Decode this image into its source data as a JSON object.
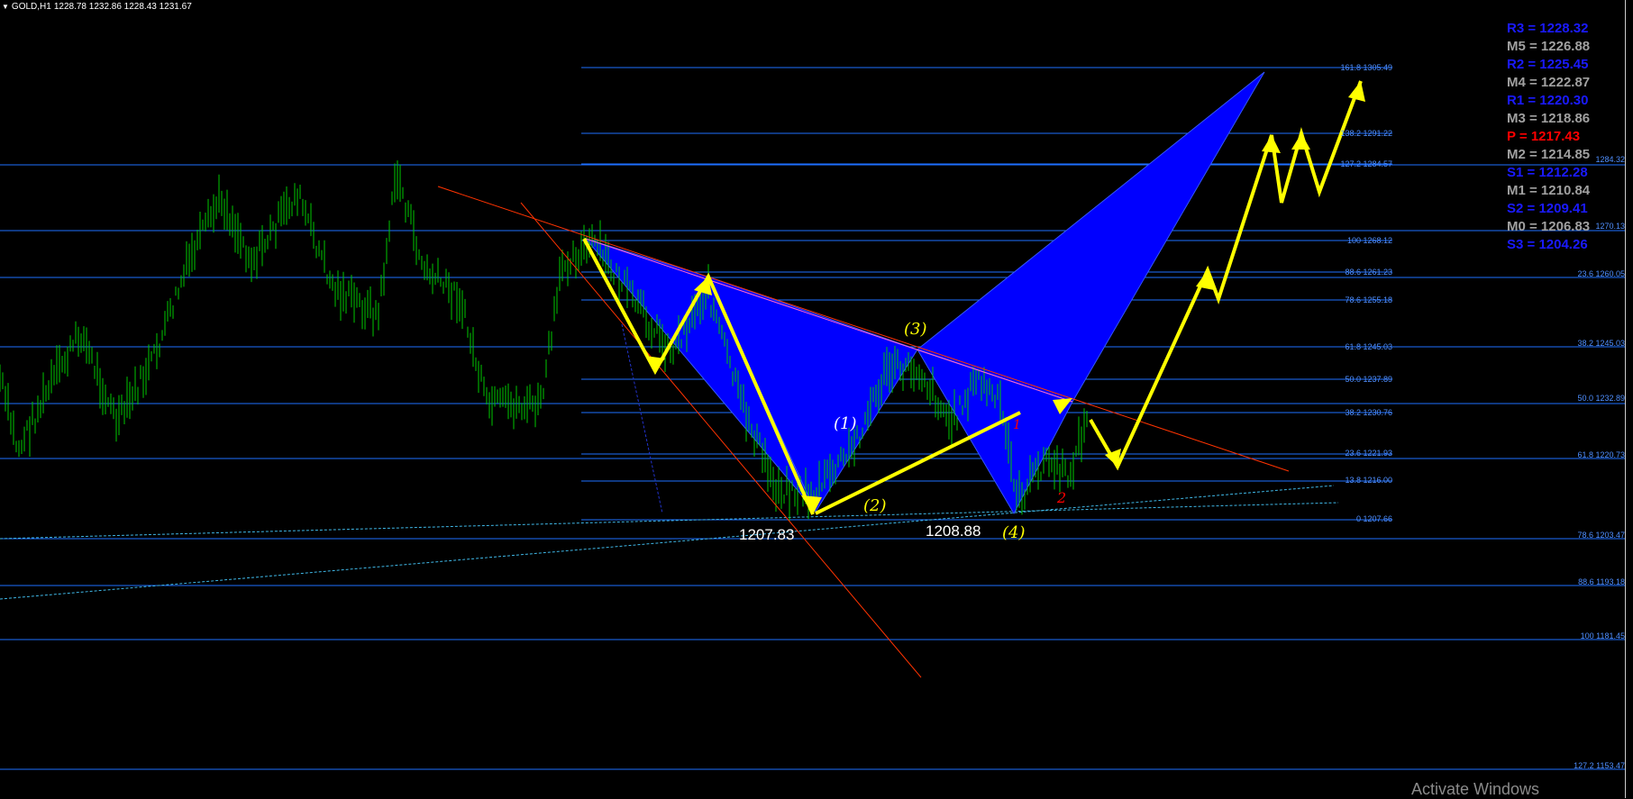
{
  "window": {
    "symbol_title": "GOLD,H1",
    "ohlc": "1228.78 1232.86 1228.43 1231.67"
  },
  "colors": {
    "background": "#000000",
    "candles": "#00c800",
    "fib_lines": "#1e6fff",
    "harmonic_fill": "#0000ff",
    "projection_arrows": "#ffff00",
    "trendline": "#ff3300",
    "pivot_blue": "#0000ff",
    "pivot_gray": "#909090",
    "pivot_red": "#ff0000"
  },
  "pivots": [
    {
      "label": "R3 = 1228.32",
      "color": "#1a1aff"
    },
    {
      "label": "M5 = 1226.88",
      "color": "#a0a0a0"
    },
    {
      "label": "R2 = 1225.45",
      "color": "#1a1aff"
    },
    {
      "label": "M4 = 1222.87",
      "color": "#a0a0a0"
    },
    {
      "label": "R1 = 1220.30",
      "color": "#1a1aff"
    },
    {
      "label": "M3 = 1218.86",
      "color": "#a0a0a0"
    },
    {
      "label": "P   = 1217.43",
      "color": "#ff0000"
    },
    {
      "label": "M2 = 1214.85",
      "color": "#a0a0a0"
    },
    {
      "label": "S1 = 1212.28",
      "color": "#1a1aff"
    },
    {
      "label": "M1 = 1210.84",
      "color": "#a0a0a0"
    },
    {
      "label": "S2 = 1209.41",
      "color": "#1a1aff"
    },
    {
      "label": "M0 = 1206.83",
      "color": "#a0a0a0"
    },
    {
      "label": "S3 = 1204.26",
      "color": "#1a1aff"
    }
  ],
  "fib_levels_inner": [
    "161.8 1305.49",
    "138.2 1291.22",
    "127.2 1284.57",
    "100 1268.12",
    "88.6 1261.23",
    "78.6 1255.18",
    "61.8 1245.03",
    "50.0 1237.89",
    "38.2 1230.76",
    "23.6 1221.93",
    "13.8 1216.00",
    "0 1207.66"
  ],
  "fib_levels_outer": [
    "1284.32",
    "1270.13",
    "23.6 1260.05",
    "38.2 1245.03",
    "50.0 1232.89",
    "61.8 1220.73",
    "78.6 1203.47",
    "88.6 1193.18",
    "100 1181.45",
    "127.2 1153.47"
  ],
  "price_labels": {
    "low_a": "1207.83",
    "low_b": "1208.88"
  },
  "wave_labels": {
    "w1": "(1)",
    "w2": "(2)",
    "w3": "(3)",
    "w4": "(4)",
    "r1": "1",
    "r2": "2"
  },
  "watermark": "Activate Windows"
}
